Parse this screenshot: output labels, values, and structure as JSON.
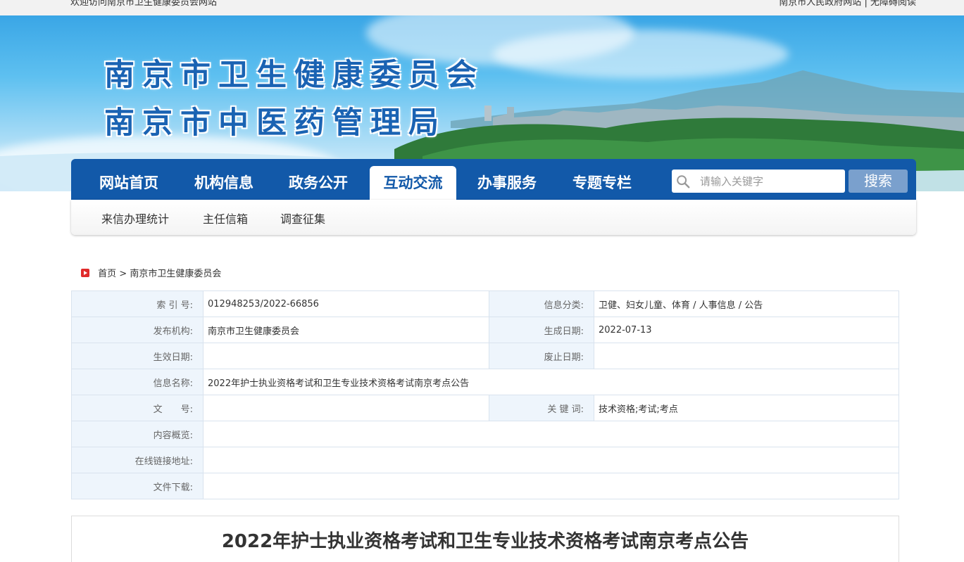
{
  "topbar": {
    "welcome": "欢迎访问南京市卫生健康委员会网站",
    "gov_link": "南京市人民政府网站",
    "separator": "|",
    "accessible": "无障碍阅读"
  },
  "banner": {
    "title_line1": "南京市卫生健康委员会",
    "title_line2": "南京市中医药管理局"
  },
  "nav": {
    "items": [
      "网站首页",
      "机构信息",
      "政务公开",
      "互动交流",
      "办事服务",
      "专题专栏"
    ],
    "active_index": 3,
    "search_placeholder": "请输入关键字",
    "search_button": "搜索"
  },
  "subnav": {
    "items": [
      "来信办理统计",
      "主任信箱",
      "调查征集"
    ]
  },
  "breadcrumb": {
    "home": "首页",
    "sep": ">",
    "current": "南京市卫生健康委员会"
  },
  "meta": {
    "index_label": "索 引 号:",
    "index_value": "012948253/2022-66856",
    "category_label": "信息分类:",
    "category_value": "卫健、妇女儿童、体育 / 人事信息 / 公告",
    "publisher_label": "发布机构:",
    "publisher_value": "南京市卫生健康委员会",
    "created_label": "生成日期:",
    "created_value": "2022-07-13",
    "effective_label": "生效日期:",
    "effective_value": "",
    "expire_label": "废止日期:",
    "expire_value": "",
    "name_label": "信息名称:",
    "name_value": "2022年护士执业资格考试和卫生专业技术资格考试南京考点公告",
    "docno_label": "文　　号:",
    "docno_value": "",
    "keywords_label": "关 键 词:",
    "keywords_value": "技术资格;考试;考点",
    "summary_label": "内容概览:",
    "summary_value": "",
    "link_label": "在线链接地址:",
    "link_value": "",
    "download_label": "文件下载:",
    "download_value": ""
  },
  "article": {
    "title": "2022年护士执业资格考试和卫生专业技术资格考试南京考点公告"
  }
}
